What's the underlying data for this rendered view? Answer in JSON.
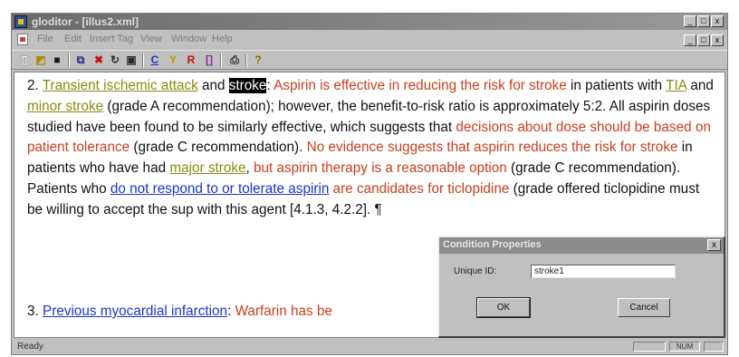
{
  "window": {
    "title": "gloditor - [illus2.xml]",
    "controls": [
      "_",
      "□",
      "x"
    ],
    "doc_controls": [
      "_",
      "□",
      "x"
    ]
  },
  "menu": [
    "File",
    "Edit",
    "Insert Tag",
    "View",
    "Window",
    "Help"
  ],
  "toolbar": {
    "buttons": [
      {
        "icon": "new-doc-icon",
        "glyph": "▯"
      },
      {
        "icon": "open-folder-icon",
        "glyph": "◩"
      },
      {
        "icon": "save-icon",
        "glyph": "■"
      },
      {
        "icon": "copy-icon",
        "glyph": "⧉"
      },
      {
        "icon": "delete-x-icon",
        "glyph": "✖"
      },
      {
        "icon": "refresh-icon",
        "glyph": "↻"
      },
      {
        "icon": "tag-icon",
        "glyph": "▣"
      },
      {
        "icon": "letter-c-icon",
        "glyph": "C"
      },
      {
        "icon": "letter-y-icon",
        "glyph": "Y"
      },
      {
        "icon": "letter-r-icon",
        "glyph": "R"
      },
      {
        "icon": "bracket-icon",
        "glyph": "[]"
      },
      {
        "icon": "print-icon",
        "glyph": "⎙"
      },
      {
        "icon": "help-bulb-icon",
        "glyph": "?"
      }
    ]
  },
  "document": {
    "p1": [
      {
        "t": "2. ",
        "s": "plain"
      },
      {
        "t": "Transient ischemic attack",
        "s": "olive"
      },
      {
        "t": " and ",
        "s": "plain"
      },
      {
        "t": "stroke",
        "s": "hl"
      },
      {
        "t": ":  ",
        "s": "plain"
      },
      {
        "t": "Aspirin is effective in reducing the risk for stroke",
        "s": "red"
      },
      {
        "t": " in patients with ",
        "s": "plain"
      },
      {
        "t": "TIA",
        "s": "olive"
      },
      {
        "t": " and ",
        "s": "plain"
      },
      {
        "t": "minor stroke",
        "s": "olive"
      },
      {
        "t": " (grade A recommendation); however, the benefit-to-risk ratio is approximately 5:2.  All aspirin doses studied have been found to be similarly effective, which suggests that ",
        "s": "plain"
      },
      {
        "t": "decisions about dose should be based on patient tolerance",
        "s": "red"
      },
      {
        "t": " (grade C recommendation).  ",
        "s": "plain"
      },
      {
        "t": "No evidence suggests that aspirin reduces the risk for stroke",
        "s": "red"
      },
      {
        "t": " in patients who have had ",
        "s": "plain"
      },
      {
        "t": "major stroke",
        "s": "olive"
      },
      {
        "t": ",  ",
        "s": "plain"
      },
      {
        "t": "but aspirin therapy is a reasonable option",
        "s": "red"
      },
      {
        "t": " (grade C recommendation).  Patients who ",
        "s": "plain"
      },
      {
        "t": "do not respond to or tolerate aspirin",
        "s": "blue"
      },
      {
        "t": " ",
        "s": "plain"
      },
      {
        "t": "are candidates for ticlopidine",
        "s": "red"
      },
      {
        "t": " (grade",
        "s": "plain"
      },
      {
        "t": " offered ticlopidine must be willing to accept the sup",
        "s": "plain"
      },
      {
        "t": " with this agent [4.1.3, 4.2.2].  ¶",
        "s": "plain"
      }
    ],
    "p2": [
      {
        "t": "3. ",
        "s": "plain"
      },
      {
        "t": "Previous myocardial infarction",
        "s": "blue"
      },
      {
        "t": ":  ",
        "s": "plain"
      },
      {
        "t": "Warfarin has be",
        "s": "red"
      }
    ]
  },
  "status": {
    "text": "Ready",
    "indicator": "NUM"
  },
  "dialog": {
    "title": "Condition Properties",
    "close": "x",
    "uid_label": "Unique ID:",
    "uid_value": "stroke1",
    "ok": "OK",
    "cancel": "Cancel"
  }
}
